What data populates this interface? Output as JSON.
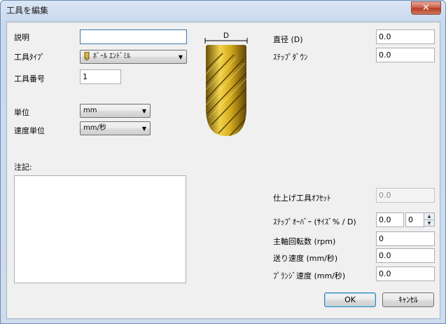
{
  "window": {
    "title": "工具を編集",
    "close_label": "✕"
  },
  "left": {
    "description_label": "説明",
    "description_value": "",
    "tool_type_label": "工具ﾀｲﾌﾟ",
    "tool_type_value": "ﾎﾞｰﾙ ｴﾝﾄﾞﾐﾙ",
    "tool_number_label": "工具番号",
    "tool_number_value": "1",
    "unit_label": "単位",
    "unit_value": "mm",
    "speed_unit_label": "速度単位",
    "speed_unit_value": "mm/秒",
    "notes_label": "注記:",
    "notes_value": ""
  },
  "diagram": {
    "dimension_label": "D"
  },
  "right": {
    "diameter_label": "直径 (D)",
    "diameter_value": "0.0",
    "stepdown_label": "ｽﾃｯﾌﾟﾀﾞｳﾝ",
    "stepdown_value": "0.0",
    "finish_offset_label": "仕上げ工具ｵﾌｾｯﾄ",
    "finish_offset_value": "0.0",
    "stepover_label": "ｽﾃｯﾌﾟｵｰﾊﾞｰ (ｻｲｽﾞ% / D)",
    "stepover_value": "0.0",
    "stepover_percent_value": "0",
    "spindle_speed_label": "主軸回転数 (rpm)",
    "spindle_speed_value": "0",
    "feed_rate_label": "送り速度 (mm/秒)",
    "feed_rate_value": "0.0",
    "plunge_rate_label": "ﾌﾟﾗﾝｼﾞ速度 (mm/秒)",
    "plunge_rate_value": "0.0"
  },
  "buttons": {
    "ok": "OK",
    "cancel": "ｷｬﾝｾﾙ"
  },
  "colors": {
    "tool_gold": "#c9a21a",
    "accent_border": "#3d7bad"
  }
}
